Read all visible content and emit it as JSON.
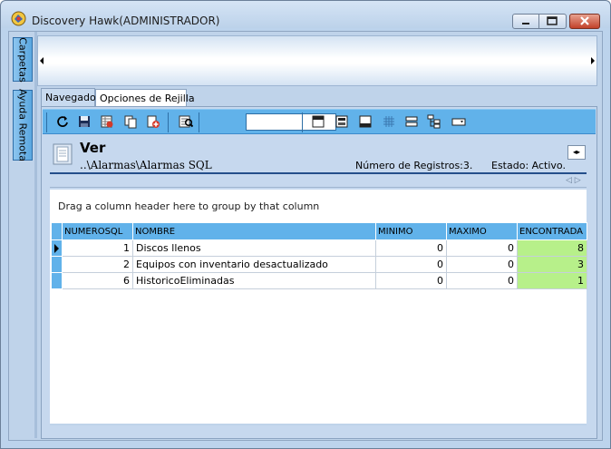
{
  "window": {
    "title": "Discovery Hawk(ADMINISTRADOR)"
  },
  "sidebar": {
    "tabs": [
      {
        "label": "Carpetas"
      },
      {
        "label": "Ayuda Remota"
      }
    ]
  },
  "tabs": [
    {
      "label": "Navegador"
    },
    {
      "label": "Opciones de Rejilla"
    }
  ],
  "toolbar": {
    "search_value": ""
  },
  "view": {
    "title": "Ver",
    "path": "..\\Alarmas\\Alarmas SQL",
    "record_count": "Número de Registros:3.",
    "status": "Estado: Activo."
  },
  "grid": {
    "group_hint": "Drag a column header here to group by that column",
    "columns": [
      "NUMEROSQL",
      "NOMBRE",
      "MINIMO",
      "MAXIMO",
      "ENCONTRADA"
    ],
    "rows": [
      {
        "numerosql": "1",
        "nombre": "Discos llenos",
        "minimo": "0",
        "maximo": "0",
        "encontrada": "8"
      },
      {
        "numerosql": "2",
        "nombre": "Equipos con inventario desactualizado",
        "minimo": "0",
        "maximo": "0",
        "encontrada": "3"
      },
      {
        "numerosql": "6",
        "nombre": "HistoricoEliminadas",
        "minimo": "0",
        "maximo": "0",
        "encontrada": "1"
      }
    ]
  },
  "colors": {
    "accent": "#61b2ea",
    "found_highlight": "#b7f08a",
    "background": "#bfd3ea"
  }
}
